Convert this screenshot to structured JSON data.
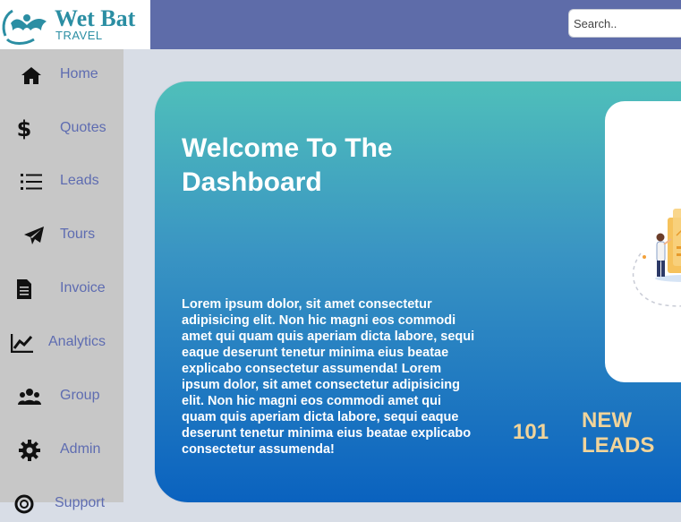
{
  "header": {
    "brand_name": "Wet Bat",
    "brand_sub": "TRAVEL",
    "search_placeholder": "Search.."
  },
  "sidebar": {
    "items": [
      {
        "label": "Home",
        "icon": "home-icon"
      },
      {
        "label": "Quotes",
        "icon": "dollar-icon"
      },
      {
        "label": "Leads",
        "icon": "list-icon"
      },
      {
        "label": "Tours",
        "icon": "paper-plane-icon"
      },
      {
        "label": "Invoice",
        "icon": "document-icon"
      },
      {
        "label": "Analytics",
        "icon": "chart-line-icon"
      },
      {
        "label": "Group",
        "icon": "users-icon"
      },
      {
        "label": "Admin",
        "icon": "gear-icon"
      },
      {
        "label": "Support",
        "icon": "support-icon"
      }
    ]
  },
  "main": {
    "title": "Welcome To The Dashboard",
    "body": "Lorem ipsum dolor, sit amet consectetur adipisicing elit. Non hic magni eos commodi amet qui quam quis aperiam dicta labore, sequi eaque deserunt tenetur minima eius beatae explicabo consectetur assumenda! Lorem ipsum dolor, sit amet consectetur adipisicing elit. Non hic magni eos commodi amet qui quam quis aperiam dicta labore, sequi eaque deserunt tenetur minima eius beatae explicabo consectetur assumenda!",
    "leads_count": "101",
    "leads_label": "NEW LEADS"
  },
  "colors": {
    "topbar": "#5e6ca9",
    "sidebar": "#c7c7c7",
    "nav_text": "#5e6cb1",
    "accent_gold": "#f1d49a",
    "brand_teal": "#2b8ea3"
  }
}
